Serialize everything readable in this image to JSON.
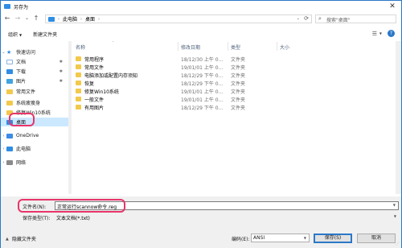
{
  "window": {
    "title": "另存为",
    "close_glyph": "✕"
  },
  "address": {
    "back": "←",
    "forward": "→",
    "dropdown": "⌄",
    "up": "↑",
    "crumbs": [
      "此电脑",
      "桌面"
    ],
    "refresh": "⟳",
    "search_placeholder": "搜索\"桌面\""
  },
  "toolbar": {
    "organize": "组织",
    "new_folder": "新建文件夹"
  },
  "nav": {
    "items": [
      {
        "label": "快速访问",
        "icon": "star-icon",
        "expanded": true
      },
      {
        "label": "文档",
        "icon": "document-icon",
        "pinned": true
      },
      {
        "label": "下载",
        "icon": "download-icon",
        "pinned": true
      },
      {
        "label": "图片",
        "icon": "pictures-icon",
        "pinned": true
      },
      {
        "label": "常用文件",
        "icon": "folder-icon"
      },
      {
        "label": "系统疲瘦身",
        "icon": "folder-icon"
      },
      {
        "label": "修复Win10系统",
        "icon": "folder-icon"
      },
      {
        "label": "桌面",
        "icon": "desktop-icon",
        "selected": true
      },
      {
        "label": "OneDrive",
        "icon": "cloud-icon"
      },
      {
        "label": "此电脑",
        "icon": "computer-icon"
      },
      {
        "label": "网络",
        "icon": "network-icon"
      }
    ]
  },
  "list": {
    "columns": [
      "名称",
      "修改日期",
      "类型",
      "大小"
    ],
    "rows": [
      {
        "name": "常用程序",
        "date": "18/12/30 上午 0...",
        "type": "文件夹"
      },
      {
        "name": "常用文件",
        "date": "19/01/01 上午 0...",
        "type": "文件夹"
      },
      {
        "name": "电脑添加或配置内存须知",
        "date": "18/12/29 下午 0...",
        "type": "文件夹"
      },
      {
        "name": "恢复",
        "date": "18/12/29 下午 0...",
        "type": "文件夹"
      },
      {
        "name": "修复Win10系统",
        "date": "19/01/01 上午 0...",
        "type": "文件夹"
      },
      {
        "name": "一般文件",
        "date": "19/01/01 上午 0...",
        "type": "文件夹"
      },
      {
        "name": "有用图片",
        "date": "18/12/29 下午 0...",
        "type": "文件夹"
      }
    ]
  },
  "fields": {
    "filename_label": "文件名(N):",
    "filename_value": "正常运行scannow命令.reg",
    "filetype_label": "保存类型(T):",
    "filetype_value": "文本文档(*.txt)"
  },
  "footer": {
    "hide_folders": "隐藏文件夹",
    "encoding_label": "编码(E):",
    "encoding_value": "ANSI",
    "save": "保存(S)",
    "cancel": "取消"
  },
  "colors": {
    "accent": "#2b78c7",
    "highlight": "#e8356b",
    "selection": "#cce8ff"
  }
}
